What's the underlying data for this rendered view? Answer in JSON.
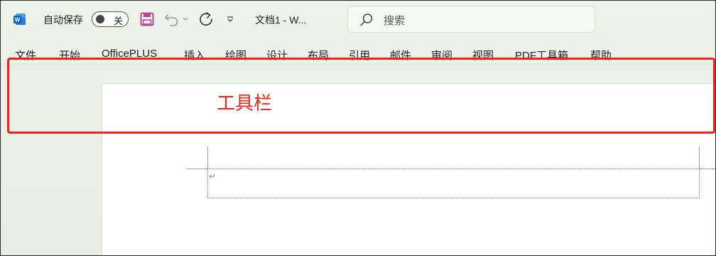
{
  "titlebar": {
    "app_icon": "word-logo-icon",
    "autosave_label": "自动保存",
    "autosave_state": "关",
    "doc_title": "文档1  -  W..."
  },
  "search": {
    "placeholder": "搜索"
  },
  "tabs": [
    "文件",
    "开始",
    "OfficePLUS",
    "插入",
    "绘图",
    "设计",
    "布局",
    "引用",
    "邮件",
    "审阅",
    "视图",
    "PDF工具箱",
    "帮助"
  ],
  "annotation": {
    "label": "工具栏",
    "color": "#e8281e"
  },
  "colors": {
    "accent": "#e8281e",
    "save_icon": "#b4479a",
    "word_blue": "#185abd"
  },
  "document": {
    "paragraph_mark": "↵"
  }
}
